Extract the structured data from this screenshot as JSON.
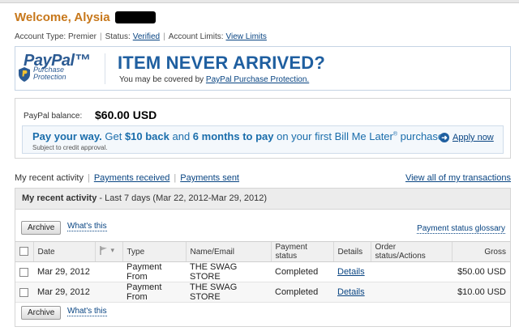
{
  "header": {
    "welcome": "Welcome, Alysia",
    "account_type_label": "Account Type: Premier",
    "status_label": "Status:",
    "status_value": "Verified",
    "limits_label": "Account Limits:",
    "limits_link": "View Limits"
  },
  "banner": {
    "logo_word": "PayPal",
    "logo_sub": "Purchase Protection",
    "title": "ITEM NEVER ARRIVED?",
    "sub_prefix": "You may be covered by ",
    "sub_link": "PayPal Purchase Protection."
  },
  "balance": {
    "label": "PayPal balance:",
    "value": "$60.00 USD"
  },
  "promo": {
    "part1": "Pay your way.",
    "part2": " Get ",
    "part3": "$10 back",
    "part4": " and ",
    "part5": "6 months to pay",
    "part6": " on your first Bill Me Later",
    "reg": "®",
    "part7": " purchase.",
    "subtext": "Subject to credit approval.",
    "apply_label": "Apply now"
  },
  "tabs": {
    "recent": "My recent activity",
    "received": "Payments received",
    "sent": "Payments sent",
    "view_all": "View all of my transactions"
  },
  "activity": {
    "title": "My recent activity",
    "range": " - Last 7 days (Mar 22, 2012-Mar 29, 2012)",
    "archive_label": "Archive",
    "whats_this": "What's this",
    "glossary": "Payment status glossary",
    "columns": {
      "date": "Date",
      "type": "Type",
      "name": "Name/Email",
      "status": "Payment status",
      "details": "Details",
      "order": "Order status/Actions",
      "gross": "Gross"
    },
    "rows": [
      {
        "date": "Mar 29, 2012",
        "type": "Payment From",
        "name": "THE SWAG STORE",
        "status": "Completed",
        "details": "Details",
        "order": "",
        "gross": "$50.00 USD"
      },
      {
        "date": "Mar 29, 2012",
        "type": "Payment From",
        "name": "THE SWAG STORE",
        "status": "Completed",
        "details": "Details",
        "order": "",
        "gross": "$10.00 USD"
      }
    ]
  },
  "colors": {
    "welcome": "#c7771a",
    "brand_blue": "#1f5fa0",
    "link": "#084482"
  }
}
